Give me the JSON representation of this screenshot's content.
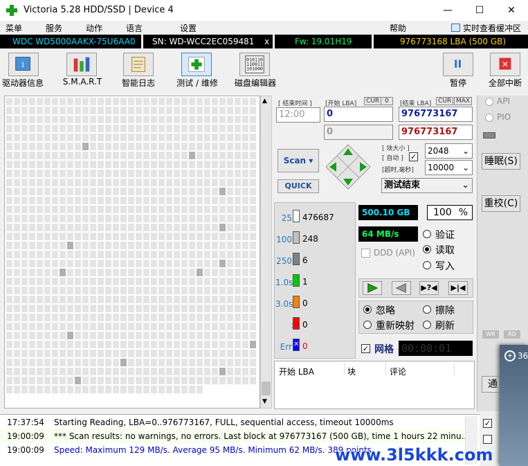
{
  "window": {
    "title": "Victoria 5.28 HDD/SSD | Device 4",
    "minimize": "—",
    "maximize": "☐",
    "close": "✕"
  },
  "menu": {
    "items": [
      "菜单",
      "服务",
      "动作",
      "语言",
      "设置"
    ],
    "help": "帮助",
    "realtime": "实时查看缓冲区"
  },
  "drive": {
    "model": "WDC WD5000AAKX-75U6AA0",
    "sn": "SN: WD-WCC2EC059481",
    "close": "x",
    "fw": "Fw: 19.01H19",
    "lba": "976773168 LBA (500 GB)"
  },
  "toolbar": {
    "items": [
      "驱动器信息",
      "S.M.A.R.T",
      "智能日志",
      "测试 / 维修",
      "磁盘编辑器"
    ],
    "pause": "暂停",
    "stop_all": "全部中断"
  },
  "controls": {
    "end_time_label": "[ 结束时间 ]",
    "end_time": "12:00",
    "start_lba_label": "[开始 LBA]",
    "cur": "CUR",
    "zero": "0",
    "end_lba_label": "[结束 LBA]",
    "max": "MAX",
    "start_lba": "0",
    "end_lba": "976773167",
    "start_lba2": "0",
    "end_lba2": "976773167",
    "block_size_label": "[ 块大小 ]",
    "auto_label": "[ 自动 ]",
    "timeout_label": "[超时,毫秒]",
    "block_size": "2048",
    "timeout": "10000",
    "scan": "Scan",
    "quick": "QUICK",
    "status": "测试结束"
  },
  "legend": [
    {
      "label": "25",
      "value": "476687",
      "color": "#ffffff"
    },
    {
      "label": "100",
      "value": "248",
      "color": "#c0c0c0"
    },
    {
      "label": "250",
      "value": "6",
      "color": "#808080"
    },
    {
      "label": "1.0s",
      "value": "1",
      "color": "#00cc00"
    },
    {
      "label": "3.0s",
      "value": "0",
      "color": "#ff8000"
    },
    {
      "label": ">",
      "value": "0",
      "color": "#ff0000"
    },
    {
      "label": "Err",
      "value": "0",
      "color": "#0000ff"
    }
  ],
  "stats": {
    "size": "500.10 GB",
    "percent": "100",
    "pct": "%",
    "speed": "64 MB/s",
    "ddd": "DDD (API)"
  },
  "modes": {
    "verify": "验证",
    "read": "读取",
    "write": "写入"
  },
  "actions": {
    "ignore": "忽略",
    "erase": "擦除",
    "remap": "重新映射",
    "refresh": "刷新",
    "grid": "网格",
    "timer": "00:00:01"
  },
  "table": {
    "headers": [
      "开始 LBA",
      "块",
      "评论"
    ]
  },
  "side": {
    "api": "API",
    "pio": "PIO",
    "sleep": "睡眠(S)",
    "recal": "重校(C)",
    "wr": "WR",
    "rd": "RD",
    "num": "36",
    "tong": "通"
  },
  "log": [
    {
      "time": "17:37:54",
      "msg": "Starting Reading, LBA=0..976773167, FULL, sequential access, timeout 10000ms",
      "color": "#000000"
    },
    {
      "time": "19:00:09",
      "msg": "*** Scan results: no warnings, no errors. Last block at 976773167 (500 GB), time 1 hours 22 minu...",
      "color": "#000000"
    },
    {
      "time": "19:00:09",
      "msg": "Speed: Maximum 129 MB/s. Average 95 MB/s. Minimum 62 MB/s. 389 points.",
      "color": "#0000cc"
    }
  ],
  "watermark": "www.3l5kkk.com"
}
